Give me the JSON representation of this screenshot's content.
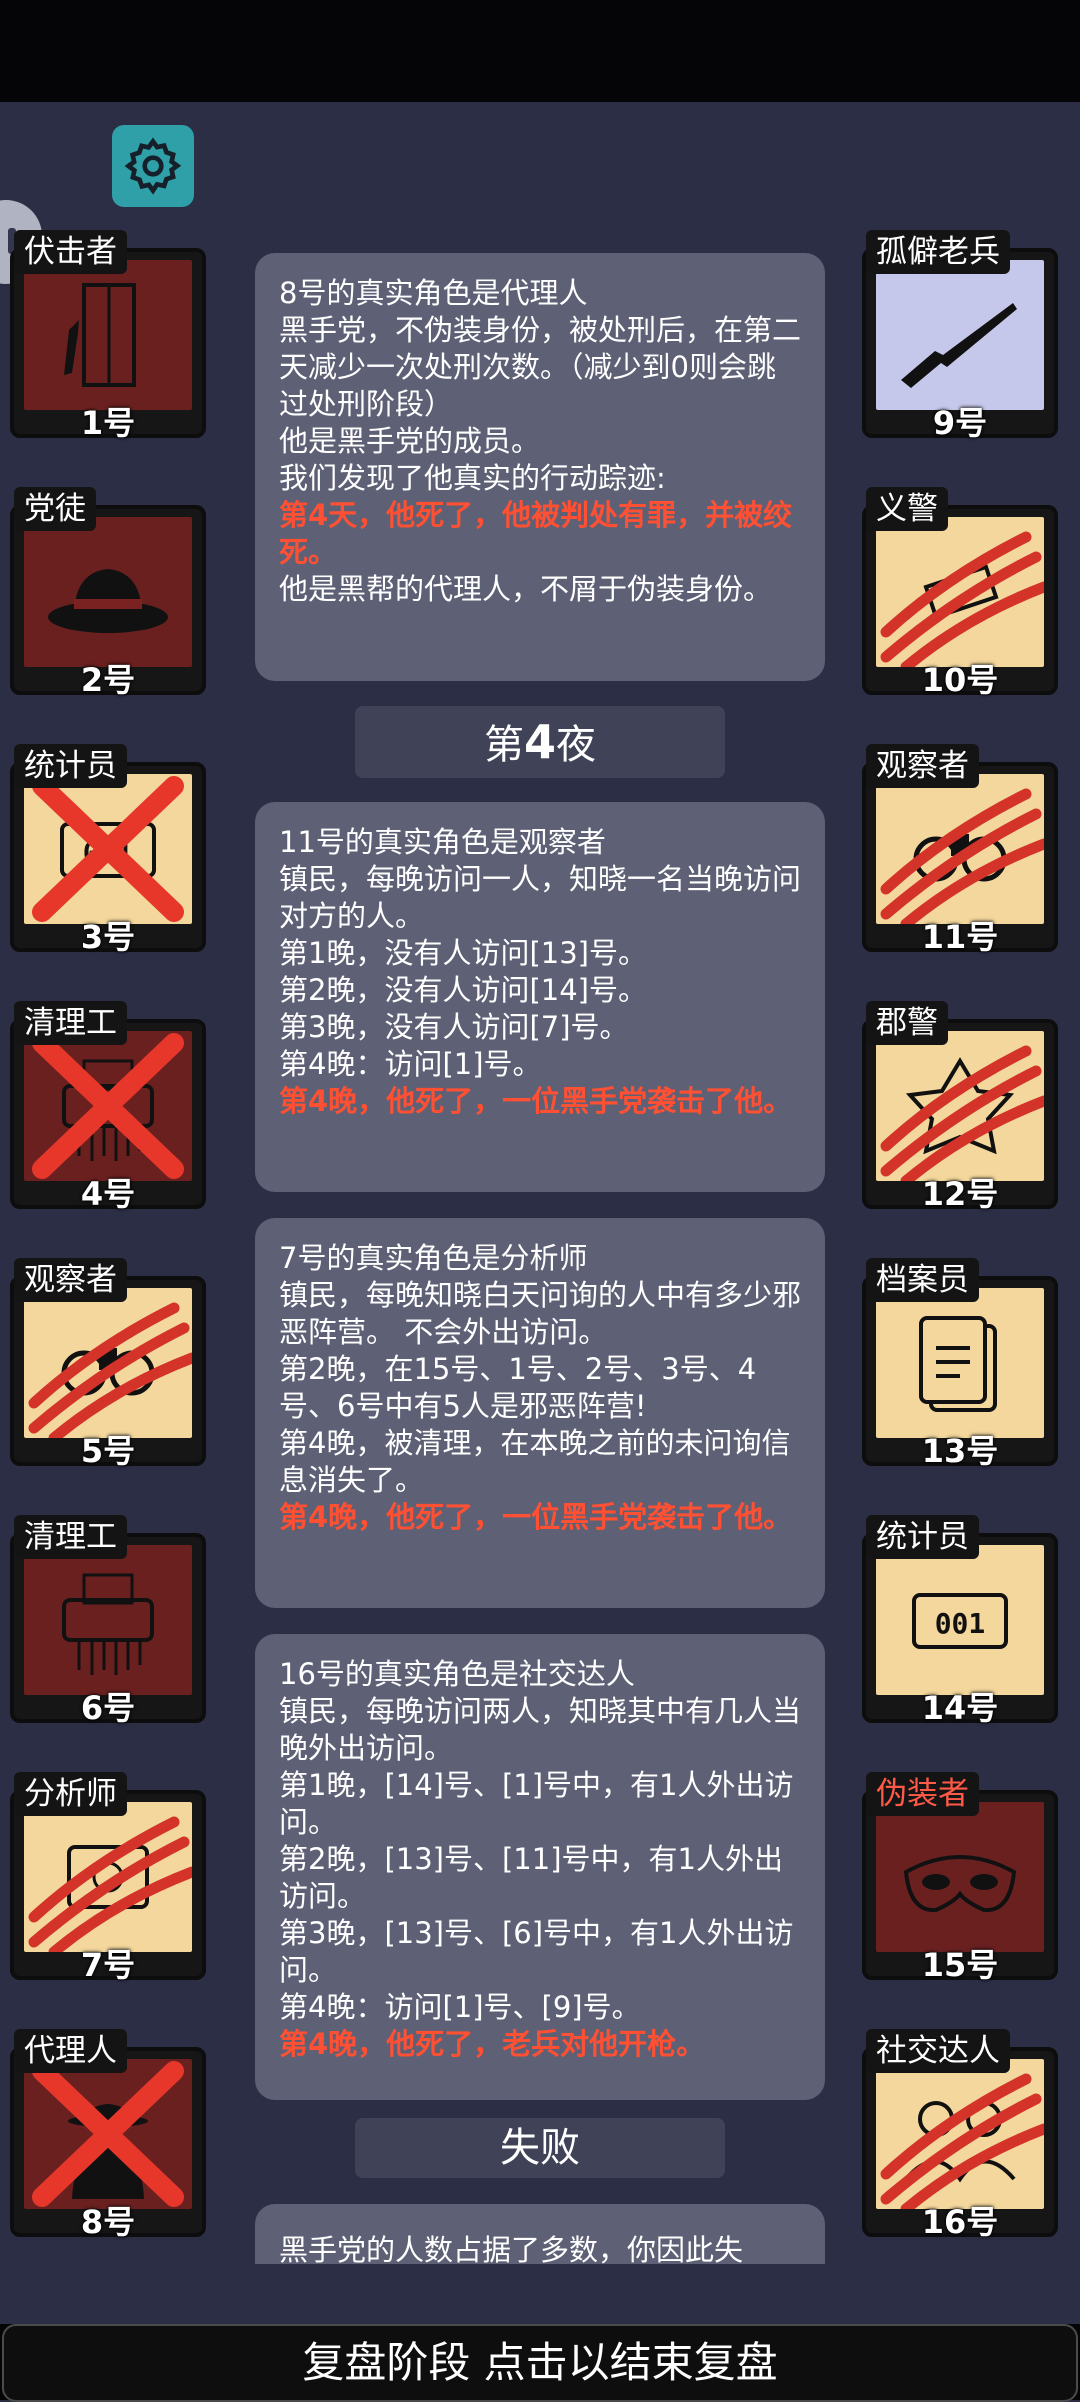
{
  "settings_icon": "gear-icon",
  "left_cards": [
    {
      "role": "伏击者",
      "num": "1号",
      "bg": "red",
      "icon": "door-knife-icon",
      "mark": ""
    },
    {
      "role": "党徒",
      "num": "2号",
      "bg": "red",
      "icon": "hat-icon",
      "mark": ""
    },
    {
      "role": "统计员",
      "num": "3号",
      "bg": "tan",
      "icon": "counter-icon",
      "mark": "x"
    },
    {
      "role": "清理工",
      "num": "4号",
      "bg": "red",
      "icon": "shredder-icon",
      "mark": "x"
    },
    {
      "role": "观察者",
      "num": "5号",
      "bg": "tan",
      "icon": "binoculars-icon",
      "mark": "claw"
    },
    {
      "role": "清理工",
      "num": "6号",
      "bg": "red",
      "icon": "shredder-icon",
      "mark": ""
    },
    {
      "role": "分析师",
      "num": "7号",
      "bg": "tan",
      "icon": "analyzer-icon",
      "mark": "claw"
    },
    {
      "role": "代理人",
      "num": "8号",
      "bg": "red",
      "icon": "agent-icon",
      "mark": "x"
    }
  ],
  "right_cards": [
    {
      "role": "孤僻老兵",
      "num": "9号",
      "bg": "lav",
      "icon": "rifle-icon",
      "mark": ""
    },
    {
      "role": "义警",
      "num": "10号",
      "bg": "tan",
      "icon": "vigilante-icon",
      "mark": "claw"
    },
    {
      "role": "观察者",
      "num": "11号",
      "bg": "tan",
      "icon": "binoculars-icon",
      "mark": "claw"
    },
    {
      "role": "郡警",
      "num": "12号",
      "bg": "tan",
      "icon": "badge-icon",
      "mark": "claw"
    },
    {
      "role": "档案员",
      "num": "13号",
      "bg": "tan",
      "icon": "documents-icon",
      "mark": ""
    },
    {
      "role": "统计员",
      "num": "14号",
      "bg": "tan",
      "icon": "counter-icon",
      "mark": ""
    },
    {
      "role": "伪装者",
      "num": "15号",
      "bg": "red",
      "icon": "mask-icon",
      "mark": "",
      "bad": true
    },
    {
      "role": "社交达人",
      "num": "16号",
      "bg": "tan",
      "icon": "people-icon",
      "mark": "claw"
    }
  ],
  "panels": [
    {
      "lines": [
        "8号的真实角色是代理人",
        "黑手党，不伪装身份，被处刑后，在第二天减少一次处刑次数。（减少到0则会跳过处刑阶段）",
        "他是黑手党的成员。",
        "我们发现了他真实的行动踪迹:"
      ],
      "red": "第4天，他死了，他被判处有罪，并被绞死。",
      "after": "他是黑帮的代理人，不屑于伪装身份。"
    },
    {
      "lines": [
        "11号的真实角色是观察者",
        "镇民，每晚访问一人，知晓一名当晚访问对方的人。",
        "第1晚，没有人访问[13]号。",
        "第2晚，没有人访问[14]号。",
        "第3晚，没有人访问[7]号。",
        "第4晚：访问[1]号。"
      ],
      "red": "第4晚，他死了，一位黑手党袭击了他。"
    },
    {
      "lines": [
        "7号的真实角色是分析师",
        "镇民，每晚知晓白天问询的人中有多少邪恶阵营。 不会外出访问。",
        "第2晚，在15号、1号、2号、3号、4号、6号中有5人是邪恶阵营!",
        "第4晚，被清理，在本晚之前的未问询信息消失了。"
      ],
      "red": "第4晚，他死了，一位黑手党袭击了他。"
    },
    {
      "lines": [
        "16号的真实角色是社交达人",
        "镇民，每晚访问两人，知晓其中有几人当晚外出访问。",
        "第1晚，[14]号、[1]号中，有1人外出访问。",
        "第2晚，[13]号、[11]号中，有1人外出访问。",
        "第3晚，[13]号、[6]号中，有1人外出访问。",
        "第4晚：访问[1]号、[9]号。"
      ],
      "red": "第4晚，他死了，老兵对他开枪。"
    }
  ],
  "night_header": {
    "prefix": "第",
    "num": "4",
    "suffix": "夜"
  },
  "fail_header": "失败",
  "last_panel_text": "黑手党的人数占据了多数，你因此失",
  "bottom_button": "复盘阶段 点击以结束复盘"
}
